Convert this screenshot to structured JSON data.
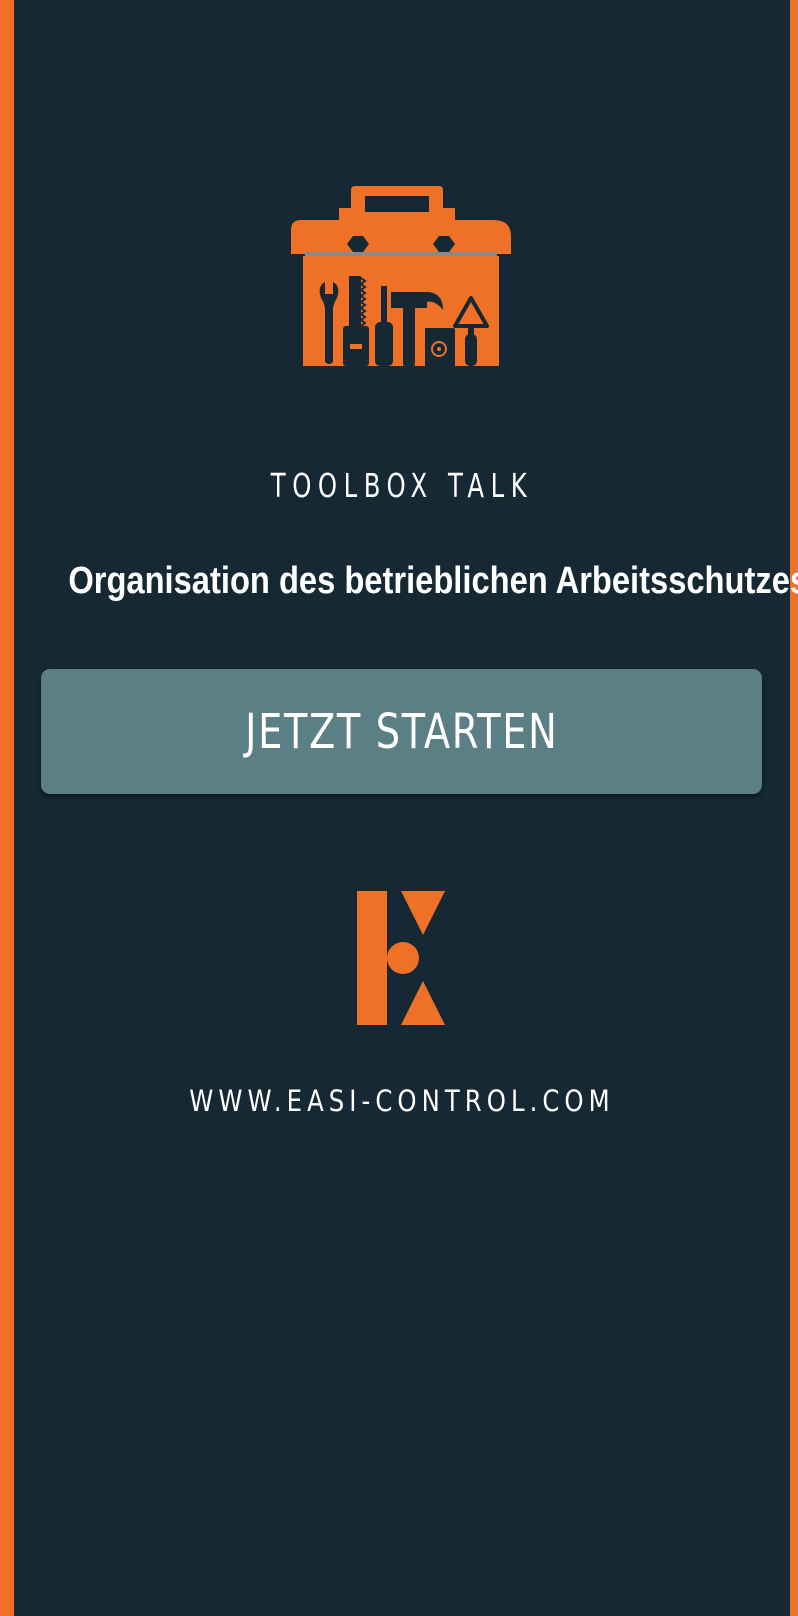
{
  "colors": {
    "background": "#172835",
    "accent": "#ee7127",
    "button": "#5a7f84",
    "text": "#ffffff"
  },
  "header": {
    "app_label": "TOOLBOX TALK",
    "topic_title": "Organisation des betrieblichen Arbeitsschutzes"
  },
  "actions": {
    "start_label": "JETZT STARTEN"
  },
  "footer": {
    "website": "WWW.EASI-CONTROL.COM"
  },
  "icons": {
    "app_logo": "toolbox-icon",
    "brand_logo": "easi-control-logo-icon"
  }
}
